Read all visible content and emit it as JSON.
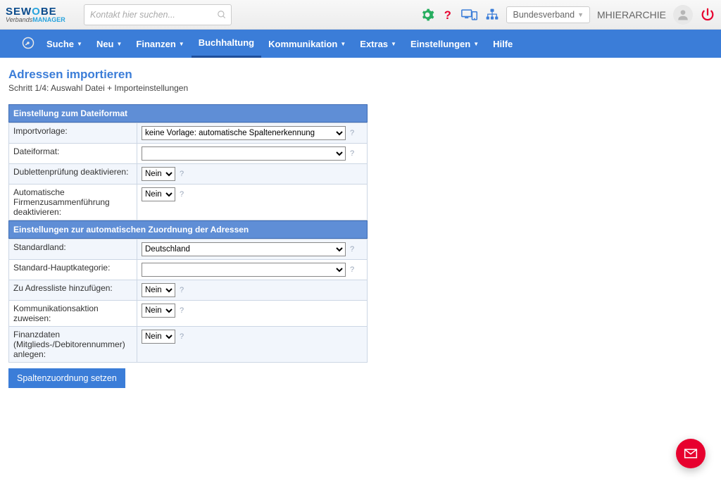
{
  "topbar": {
    "logo_top_a": "SEW",
    "logo_top_b": "O",
    "logo_top_c": "BE",
    "logo_bottom_a": "Verbands",
    "logo_bottom_b": "MANAGER",
    "search_placeholder": "Kontakt hier suchen...",
    "org_select": "Bundesverband",
    "username": "MHIERARCHIE"
  },
  "nav": {
    "items": [
      {
        "label": "Suche",
        "dropdown": true
      },
      {
        "label": "Neu",
        "dropdown": true
      },
      {
        "label": "Finanzen",
        "dropdown": true
      },
      {
        "label": "Buchhaltung",
        "dropdown": false,
        "active": true
      },
      {
        "label": "Kommunikation",
        "dropdown": true
      },
      {
        "label": "Extras",
        "dropdown": true
      },
      {
        "label": "Einstellungen",
        "dropdown": true
      },
      {
        "label": "Hilfe",
        "dropdown": false
      }
    ]
  },
  "page": {
    "title": "Adressen importieren",
    "subtitle": "Schritt 1/4: Auswahl Datei + Importeinstellungen"
  },
  "panel1": {
    "heading": "Einstellung zum Dateiformat",
    "rows": [
      {
        "label": "Importvorlage:",
        "value": "keine Vorlage: automatische Spaltenerkennung",
        "type": "wide"
      },
      {
        "label": "Dateiformat:",
        "value": "",
        "type": "wide"
      },
      {
        "label": "Dublettenprüfung deaktivieren:",
        "value": "Nein",
        "type": "narrow"
      },
      {
        "label": "Automatische Firmenzusammenführung deaktivieren:",
        "value": "Nein",
        "type": "narrow"
      }
    ]
  },
  "panel2": {
    "heading": "Einstellungen zur automatischen Zuordnung der Adressen",
    "rows": [
      {
        "label": "Standardland:",
        "value": "Deutschland",
        "type": "wide"
      },
      {
        "label": "Standard-Hauptkategorie:",
        "value": "",
        "type": "wide"
      },
      {
        "label": "Zu Adressliste hinzufügen:",
        "value": "Nein",
        "type": "narrow"
      },
      {
        "label": "Kommunikationsaktion zuweisen:",
        "value": "Nein",
        "type": "narrow"
      },
      {
        "label": "Finanzdaten (Mitglieds-/Debitorennummer) anlegen:",
        "value": "Nein",
        "type": "narrow"
      }
    ]
  },
  "buttons": {
    "submit": "Spaltenzuordnung setzen"
  },
  "help_symbol": "?"
}
